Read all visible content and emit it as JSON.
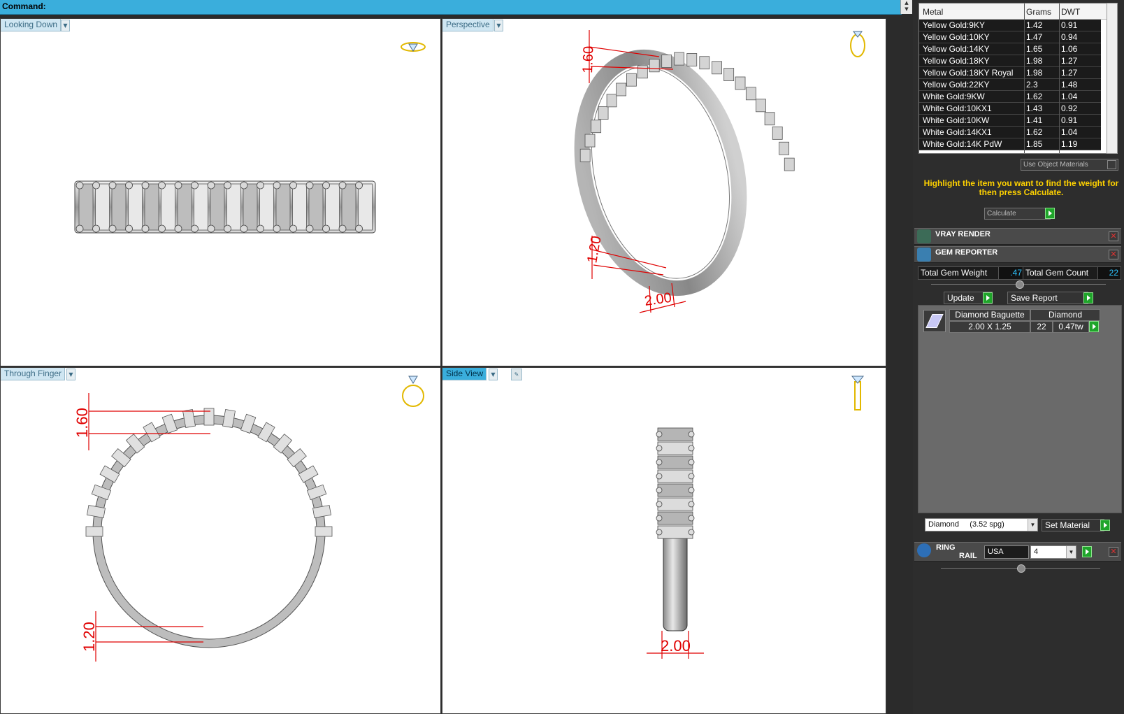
{
  "command": {
    "label": "Command:"
  },
  "viewports": {
    "top_left": {
      "label": "Looking Down"
    },
    "top_right": {
      "label": "Perspective"
    },
    "bottom_left": {
      "label": "Through Finger"
    },
    "bottom_right": {
      "label": "Side View"
    }
  },
  "dimensions": {
    "perspective": [
      "1.60",
      "1.20",
      "2.00"
    ],
    "through_finger": [
      "1.60",
      "1.20"
    ],
    "side_view": [
      "2.00"
    ]
  },
  "metal_table": {
    "headers": [
      "Metal",
      "Grams",
      "DWT"
    ],
    "rows": [
      [
        "Yellow Gold:9KY",
        "1.42",
        "0.91"
      ],
      [
        "Yellow Gold:10KY",
        "1.47",
        "0.94"
      ],
      [
        "Yellow Gold:14KY",
        "1.65",
        "1.06"
      ],
      [
        "Yellow Gold:18KY",
        "1.98",
        "1.27"
      ],
      [
        "Yellow Gold:18KY Royal",
        "1.98",
        "1.27"
      ],
      [
        "Yellow Gold:22KY",
        "2.3",
        "1.48"
      ],
      [
        "White Gold:9KW",
        "1.62",
        "1.04"
      ],
      [
        "White Gold:10KX1",
        "1.43",
        "0.92"
      ],
      [
        "White Gold:10KW",
        "1.41",
        "0.91"
      ],
      [
        "White Gold:14KX1",
        "1.62",
        "1.04"
      ],
      [
        "White Gold:14K PdW",
        "1.85",
        "1.19"
      ]
    ]
  },
  "panel": {
    "use_object_materials": "Use Object Materials",
    "hint": "Highlight the item you want to find the weight for then press Calculate.",
    "calculate": "Calculate",
    "vray_render": "VRAY RENDER",
    "gem_reporter": "GEM REPORTER",
    "total_gem_weight_label": "Total Gem Weight",
    "total_gem_weight": ".47",
    "total_gem_count_label": "Total Gem Count",
    "total_gem_count": "22",
    "update": "Update",
    "save_report": "Save Report",
    "gem": {
      "name": "Diamond Baguette",
      "material": "Diamond",
      "size": "2.00 X 1.25",
      "count": "22",
      "weight": "0.47tw"
    },
    "material_select": "Diamond     (3.52 spg)",
    "set_material": "Set Material",
    "ring_rail_1": "RING",
    "ring_rail_2": "RAIL",
    "country": "USA",
    "size": "4"
  },
  "colors": {
    "accent": "#3aaedc",
    "dimension": "#e00000",
    "hint": "#ffd200",
    "go": "#1fa52a",
    "value": "#2ec4ff"
  }
}
